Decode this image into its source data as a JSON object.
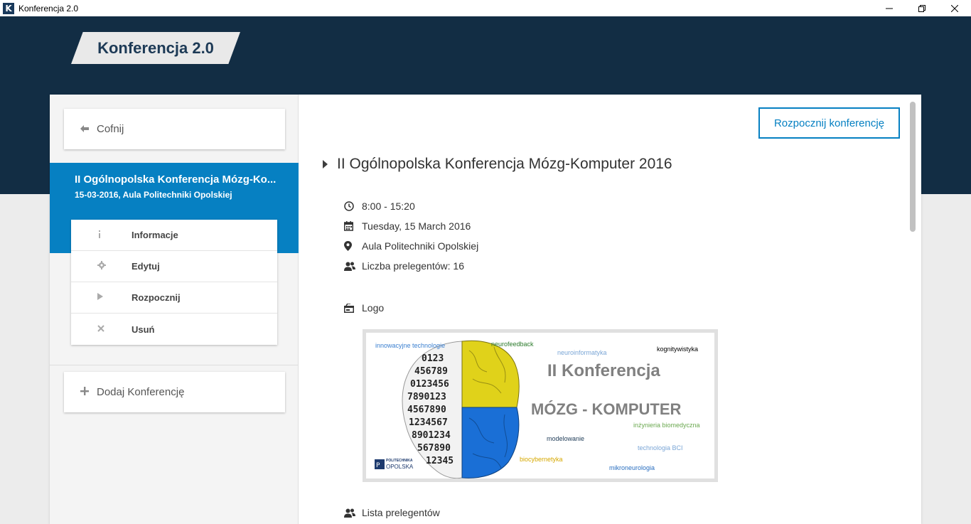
{
  "window": {
    "title": "Konferencja 2.0",
    "icon_letter": "K"
  },
  "brand": {
    "title": "Konferencja 2.0"
  },
  "sidebar": {
    "back_label": "Cofnij",
    "active_conference": {
      "title": "II Ogólnopolska Konferencja Mózg-Ko...",
      "subtitle": "15-03-2016, Aula Politechniki Opolskiej"
    },
    "menu": [
      {
        "label": "Informacje",
        "icon": "info-icon"
      },
      {
        "label": "Edytuj",
        "icon": "gear-icon"
      },
      {
        "label": "Rozpocznij",
        "icon": "play-icon"
      },
      {
        "label": "Usuń",
        "icon": "close-icon"
      }
    ],
    "add_label": "Dodaj Konferencję"
  },
  "content": {
    "start_button": "Rozpocznij konferencję",
    "heading": "II Ogólnopolska Konferencja Mózg-Komputer 2016",
    "time": "8:00 - 15:20",
    "date": "Tuesday, 15 March 2016",
    "place": "Aula Politechniki Opolskiej",
    "speakers_count": "Liczba prelegentów: 16",
    "logo_label": "Logo",
    "speakers_list_label": "Lista prelegentów",
    "logo_image": {
      "words": [
        "innowacyjne technologie",
        "neurofeedback",
        "neuroinformatyka",
        "kognitywistyka",
        "II Konferencja",
        "MÓZG - KOMPUTER",
        "inżynieria biomedyczna",
        "modelowanie",
        "technologia BCI",
        "biocybernetyka",
        "mikroneurologia"
      ],
      "university": "POLITECHNIKA",
      "university_sub": "OPOLSKA"
    }
  },
  "colors": {
    "header_bg": "#122d44",
    "accent": "#0680c2"
  }
}
